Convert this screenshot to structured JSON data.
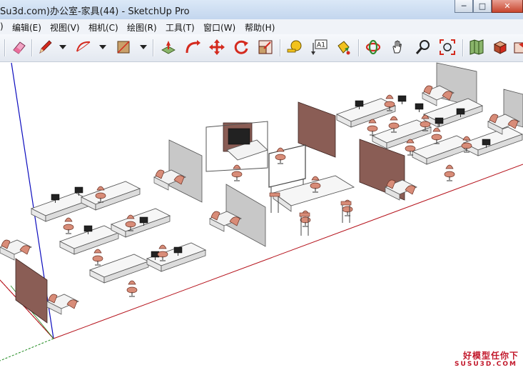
{
  "window": {
    "title": "Su3d.com)办公室-家具(44) - SketchUp Pro",
    "buttons": {
      "minimize": "─",
      "maximize": "□",
      "close": "✕"
    }
  },
  "menubar": {
    "items": [
      {
        "label": ")"
      },
      {
        "label": "编辑(E)"
      },
      {
        "label": "视图(V)"
      },
      {
        "label": "相机(C)"
      },
      {
        "label": "绘图(R)"
      },
      {
        "label": "工具(T)"
      },
      {
        "label": "窗口(W)"
      },
      {
        "label": "帮助(H)"
      }
    ]
  },
  "toolbar": {
    "tools": [
      {
        "icon": "eraser-icon"
      },
      {
        "icon": "pencil-icon"
      },
      {
        "icon": "arc-icon"
      },
      {
        "icon": "rectangle-icon"
      },
      {
        "icon": "push-pull-icon"
      },
      {
        "icon": "follow-me-icon"
      },
      {
        "icon": "move-icon"
      },
      {
        "icon": "rotate-icon"
      },
      {
        "icon": "scale-icon"
      },
      {
        "icon": "tape-measure-icon"
      },
      {
        "icon": "text-icon",
        "text": "A1"
      },
      {
        "icon": "paint-bucket-icon"
      },
      {
        "icon": "orbit-icon"
      },
      {
        "icon": "pan-icon"
      },
      {
        "icon": "zoom-icon"
      },
      {
        "icon": "zoom-extents-icon"
      },
      {
        "icon": "map-icon"
      },
      {
        "icon": "component-icon"
      },
      {
        "icon": "export-icon"
      }
    ]
  },
  "watermark": {
    "main": "好模型任你下",
    "sub": "SUSU3D.COM"
  },
  "colors": {
    "axis_red": "#b5121b",
    "axis_blue": "#0b0bbe",
    "axis_green": "#1e8a1e",
    "chair_color": "#d88c78",
    "panel_color": "#8a5d55"
  }
}
